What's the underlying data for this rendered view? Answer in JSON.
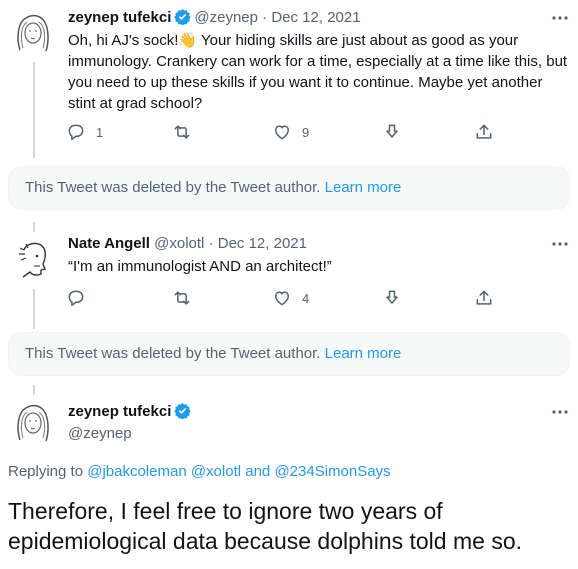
{
  "tweets": [
    {
      "name": "zeynep tufekci",
      "handle": "@zeynep",
      "sep": "·",
      "date": "Dec 12, 2021",
      "text": "Oh, hi AJ's sock!👋 Your hiding skills are just about as good as your immunology. Crankery can work for a time, especially at a time like this, but you need to up these skills if you want it to continue. Maybe yet another stint at grad school?",
      "reply_count": "1",
      "retweet_count": "",
      "like_count": "9"
    },
    {
      "name": "Nate Angell",
      "handle": "@xolotl",
      "sep": "·",
      "date": "Dec 12, 2021",
      "text": "“I'm an immunologist AND an architect!”",
      "reply_count": "",
      "retweet_count": "",
      "like_count": "4"
    }
  ],
  "deleted_notice": {
    "text": "This Tweet was deleted by the Tweet author.",
    "link": "Learn more"
  },
  "main_tweet": {
    "name": "zeynep tufekci",
    "handle": "@zeynep",
    "replying_label": "Replying to",
    "replying_mentions": "@jbakcoleman @xolotl",
    "replying_and": "and",
    "replying_last": "@234SimonSays",
    "text": "Therefore, I feel free to ignore two years of epidemiological data because dolphins told me so."
  },
  "icons": [
    "reply-icon",
    "retweet-icon",
    "like-icon",
    "share-icon",
    "more-icon",
    "verified-badge-icon"
  ],
  "colors": {
    "accent": "#1d9bf0",
    "muted": "#536471",
    "text": "#0f1419",
    "notice_bg": "#f7f9f9"
  }
}
